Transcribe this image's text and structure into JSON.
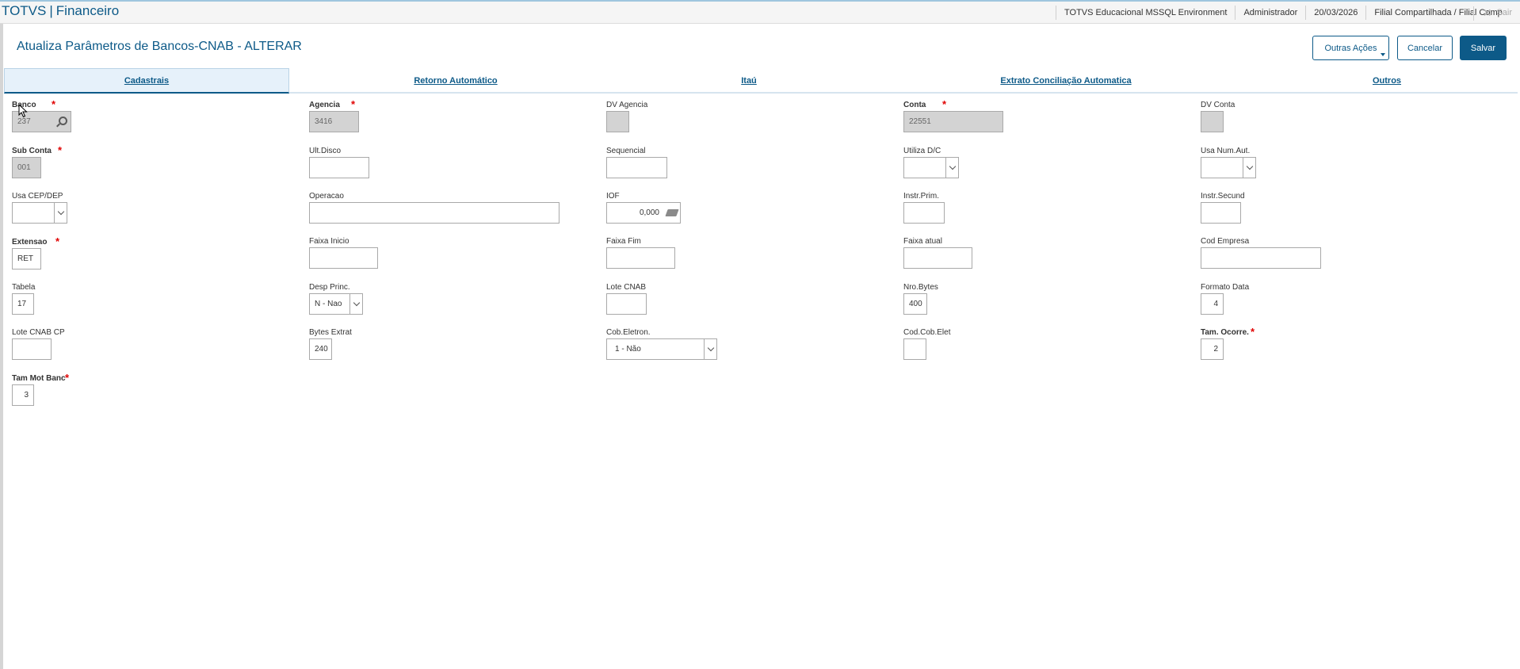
{
  "app": {
    "brand": "TOTVS",
    "module": "Financeiro"
  },
  "topbar": {
    "environment": "TOTVS Educacional MSSQL Environment",
    "user": "Administrador",
    "date": "20/03/2026",
    "branch": "Filial Compartilhada / Filial Comp",
    "exit": "Sair"
  },
  "page": {
    "title": "Atualiza Parâmetros de Bancos-CNAB - ALTERAR"
  },
  "actions": {
    "more": "Outras Ações",
    "cancel": "Cancelar",
    "save": "Salvar"
  },
  "tabs": [
    "Cadastrais",
    "Retorno Automático",
    "Itaú",
    "Extrato Conciliação Automatica",
    "Outros"
  ],
  "form": {
    "banco": {
      "label": "Banco",
      "value": "237"
    },
    "agencia": {
      "label": "Agencia",
      "value": "3416"
    },
    "dv_agencia": {
      "label": "DV Agencia",
      "value": ""
    },
    "conta": {
      "label": "Conta",
      "value": "22551"
    },
    "dv_conta": {
      "label": "DV Conta",
      "value": ""
    },
    "sub_conta": {
      "label": "Sub Conta",
      "value": "001"
    },
    "ult_disco": {
      "label": "Ult.Disco",
      "value": ""
    },
    "sequencial": {
      "label": "Sequencial",
      "value": ""
    },
    "utiliza_dc": {
      "label": "Utiliza D/C",
      "value": ""
    },
    "usa_num_aut": {
      "label": "Usa Num.Aut.",
      "value": ""
    },
    "usa_cep_dep": {
      "label": "Usa CEP/DEP",
      "value": ""
    },
    "operacao": {
      "label": "Operacao",
      "value": ""
    },
    "iof": {
      "label": "IOF",
      "value": "0,000"
    },
    "instr_prim": {
      "label": "Instr.Prim.",
      "value": ""
    },
    "instr_secund": {
      "label": "Instr.Secund",
      "value": ""
    },
    "extensao": {
      "label": "Extensao",
      "value": "RET"
    },
    "faixa_inicio": {
      "label": "Faixa Inicio",
      "value": ""
    },
    "faixa_fim": {
      "label": "Faixa Fim",
      "value": ""
    },
    "faixa_atual": {
      "label": "Faixa atual",
      "value": ""
    },
    "cod_empresa": {
      "label": "Cod Empresa",
      "value": ""
    },
    "tabela": {
      "label": "Tabela",
      "value": "17"
    },
    "desp_princ": {
      "label": "Desp Princ.",
      "value": "N - Nao"
    },
    "lote_cnab": {
      "label": "Lote CNAB",
      "value": ""
    },
    "nro_bytes": {
      "label": "Nro.Bytes",
      "value": "400"
    },
    "formato_data": {
      "label": "Formato Data",
      "value": "4"
    },
    "lote_cnab_cp": {
      "label": "Lote CNAB CP",
      "value": ""
    },
    "bytes_extrat": {
      "label": "Bytes Extrat",
      "value": "240"
    },
    "cob_eletron": {
      "label": "Cob.Eletron.",
      "value": "1 - Não"
    },
    "cod_cob_elet": {
      "label": "Cod.Cob.Elet",
      "value": ""
    },
    "tam_ocorre": {
      "label": "Tam. Ocorre.",
      "value": "2"
    },
    "tam_mot_banc": {
      "label": "Tam Mot Banc",
      "value": "3"
    }
  },
  "icons": {
    "banco_lookup": "search-icon",
    "iof_calc": "calculator-icon",
    "exit": "close-icon"
  }
}
